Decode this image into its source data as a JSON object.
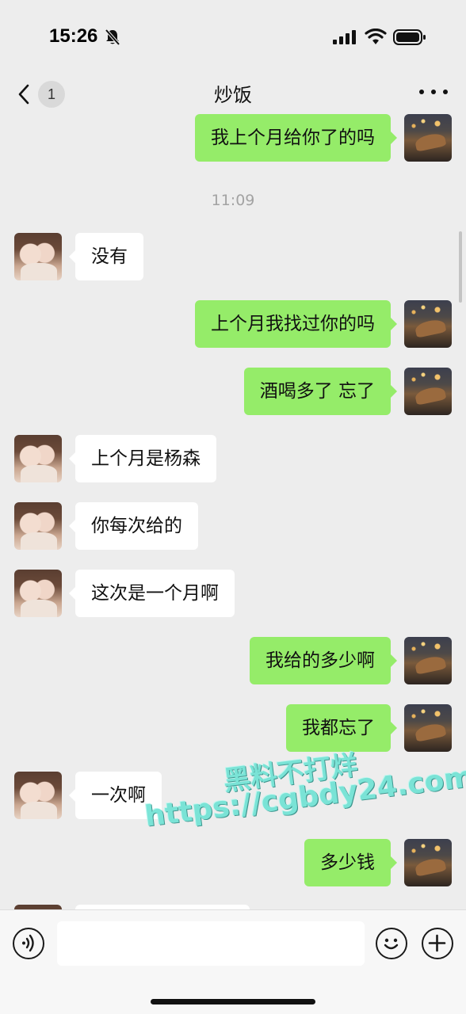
{
  "status": {
    "time": "15:26",
    "icons": [
      "bell-slash-icon",
      "cellular-signal-icon",
      "wifi-icon",
      "battery-icon"
    ]
  },
  "header": {
    "back_badge": "1",
    "title": "炒饭",
    "more_icon": "more-dots-icon"
  },
  "messages": [
    {
      "side": "out",
      "text": "我上个月给你了的吗"
    },
    {
      "type": "time",
      "text": "11:09"
    },
    {
      "side": "in",
      "text": "没有"
    },
    {
      "side": "out",
      "text": "上个月我找过你的吗"
    },
    {
      "side": "out",
      "text": "酒喝多了 忘了"
    },
    {
      "side": "in",
      "text": "上个月是杨森"
    },
    {
      "side": "in",
      "text": "你每次给的"
    },
    {
      "side": "in",
      "text": "这次是一个月啊"
    },
    {
      "side": "out",
      "text": "我给的多少啊"
    },
    {
      "side": "out",
      "text": "我都忘了"
    },
    {
      "side": "in",
      "text": "一次啊"
    },
    {
      "side": "out",
      "text": "多少钱"
    }
  ],
  "watermark": {
    "line1": "黑料不打烊",
    "line2": "https://cgbdy24.com"
  },
  "input_bar": {
    "value": "",
    "icons": [
      "voice-icon",
      "emoji-icon",
      "plus-icon"
    ]
  },
  "colors": {
    "background": "#ededed",
    "outgoing_bubble": "#95ec69",
    "incoming_bubble": "#ffffff",
    "watermark": "#6ee3d4"
  }
}
